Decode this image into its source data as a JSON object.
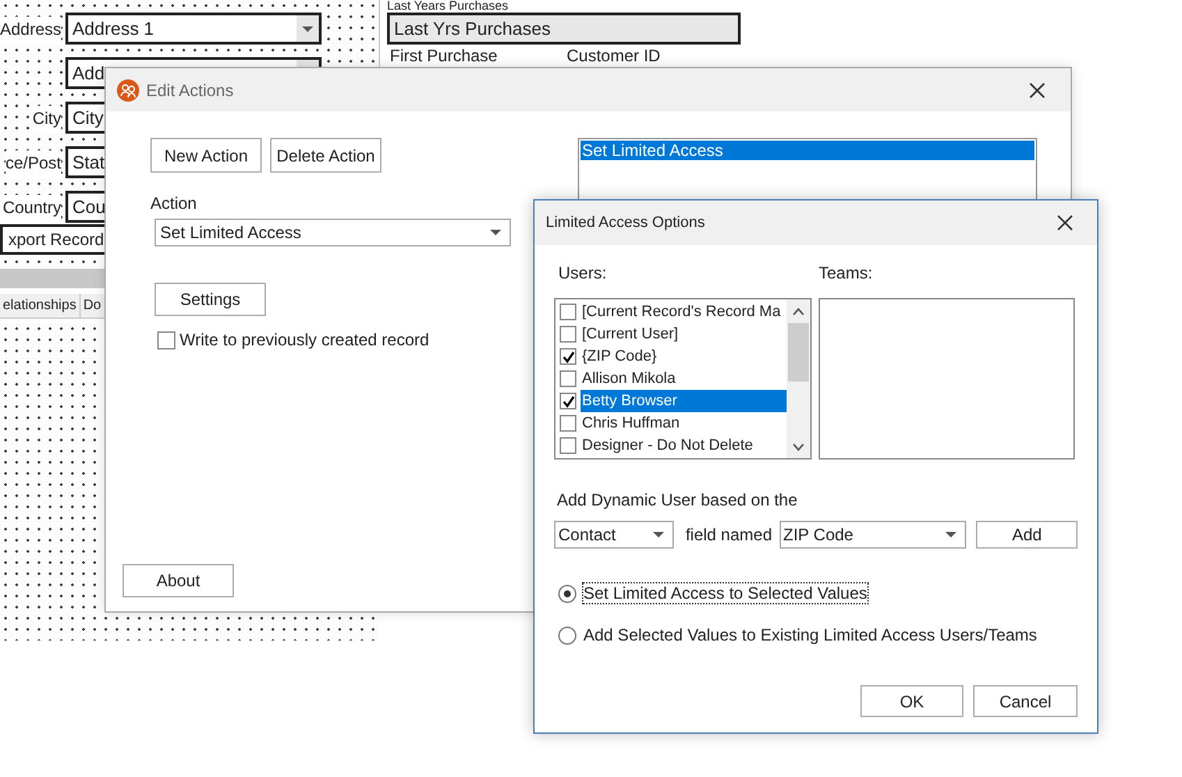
{
  "background_form": {
    "fields": [
      {
        "label": "Address",
        "value": "Address 1",
        "kind": "dropdown"
      },
      {
        "value": "Add",
        "kind": "dropdown"
      },
      {
        "label": "City",
        "value": "City",
        "kind": "text"
      },
      {
        "label": "ce/Post",
        "value": "Stat",
        "kind": "text"
      },
      {
        "label": "Country",
        "value": "Cou",
        "kind": "text"
      }
    ],
    "export_button": "xport Record",
    "tabs": [
      {
        "label": "elationships"
      },
      {
        "label": "Do"
      }
    ],
    "section_label": "Last Years Purchases",
    "purchases_dropdown": "Last Yrs Purchases",
    "labels": [
      "First Purchase",
      "Customer ID"
    ]
  },
  "edit_actions": {
    "title": "Edit Actions",
    "buttons": [
      "New Action",
      "Delete Action"
    ],
    "action_label": "Action",
    "action_value": "Set Limited Access",
    "settings_button": "Settings",
    "write_checkbox": {
      "label": "Write to previously created record",
      "checked": false
    },
    "about_button": "About",
    "actions_list": [
      {
        "label": "Set Limited Access",
        "selected": true
      }
    ]
  },
  "limited_access": {
    "title": "Limited Access Options",
    "users_label": "Users:",
    "teams_label": "Teams:",
    "users": [
      {
        "label": "[Current Record's Record Ma",
        "checked": false,
        "selected": false
      },
      {
        "label": "[Current User]",
        "checked": false,
        "selected": false
      },
      {
        "label": "{ZIP Code}",
        "checked": true,
        "selected": false
      },
      {
        "label": "Allison Mikola",
        "checked": false,
        "selected": false
      },
      {
        "label": "Betty Browser",
        "checked": true,
        "selected": true
      },
      {
        "label": "Chris Huffman",
        "checked": false,
        "selected": false
      },
      {
        "label": "Designer - Do Not Delete",
        "checked": false,
        "selected": false
      }
    ],
    "dynamic_label": "Add Dynamic User based on the",
    "object_dropdown": "Contact",
    "field_named_label": "field named",
    "field_dropdown": "ZIP Code",
    "add_button": "Add",
    "options": [
      {
        "label": "Set Limited Access to Selected Values",
        "selected": true
      },
      {
        "label": "Add Selected Values to Existing Limited Access Users/Teams",
        "selected": false
      }
    ],
    "ok_button": "OK",
    "cancel_button": "Cancel"
  }
}
